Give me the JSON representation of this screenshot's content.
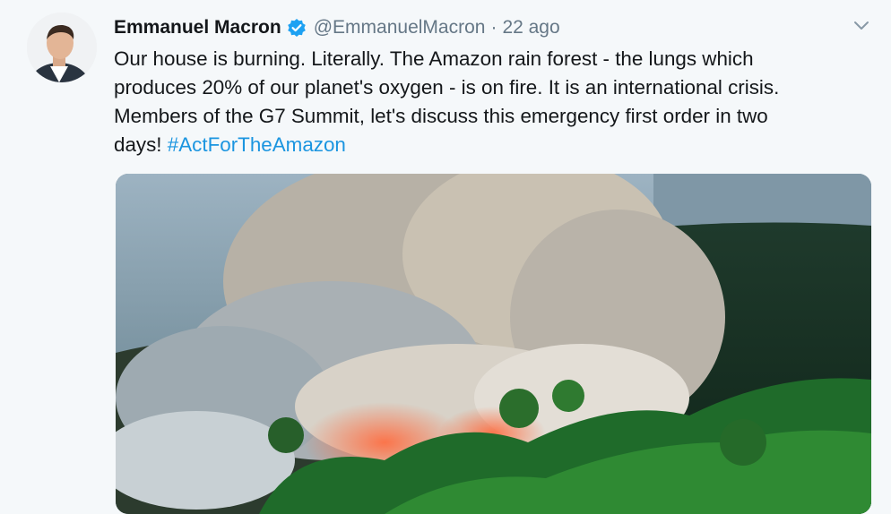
{
  "tweet": {
    "display_name": "Emmanuel Macron",
    "handle": "@EmmanuelMacron",
    "separator": "·",
    "time": "22 ago",
    "text_lines": [
      "Our house is burning. Literally. The Amazon rain forest - the lungs which",
      "produces 20% of our planet's oxygen - is on fire. It is an international crisis.",
      "Members of the G7 Summit, let's discuss this emergency first order in two",
      "days!"
    ],
    "hashtag": "#ActForTheAmazon",
    "icons": {
      "verified": "verified-badge-icon",
      "menu": "chevron-down-icon"
    }
  },
  "colors": {
    "background": "#f5f8fa",
    "text": "#14171a",
    "secondary": "#657786",
    "link": "#1b95e0",
    "verified": "#1da1f2"
  }
}
